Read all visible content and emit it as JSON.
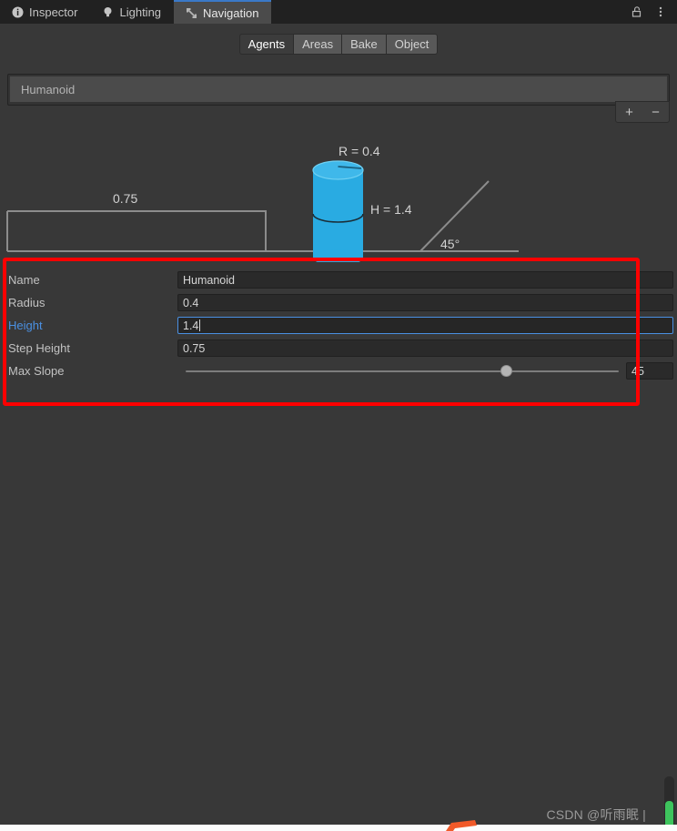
{
  "window": {
    "tabs": [
      {
        "label": "Inspector",
        "icon": "info-icon",
        "active": false
      },
      {
        "label": "Lighting",
        "icon": "lightbulb-icon",
        "active": false
      },
      {
        "label": "Navigation",
        "icon": "navmesh-icon",
        "active": true
      }
    ],
    "lock_icon": "lock-icon",
    "menu_icon": "kebab-menu-icon"
  },
  "toolbar": {
    "segments": [
      {
        "label": "Agents",
        "active": true
      },
      {
        "label": "Areas",
        "active": false
      },
      {
        "label": "Bake",
        "active": false
      },
      {
        "label": "Object",
        "active": false
      }
    ]
  },
  "agent_list": {
    "items": [
      {
        "label": "Humanoid",
        "selected": true
      }
    ],
    "add_label": "+",
    "remove_label": "−"
  },
  "diagram": {
    "step_label": "0.75",
    "radius_label": "R = 0.4",
    "height_label": "H = 1.4",
    "slope_label": "45°",
    "agent_color": "#29abe2",
    "agent_color_dark": "#1f9ed4",
    "line_color": "#8c8c8c"
  },
  "properties": {
    "highlight_color": "#fe0000",
    "rows": [
      {
        "label": "Name",
        "value": "Humanoid",
        "focused": false,
        "label_highlight": false
      },
      {
        "label": "Radius",
        "value": "0.4",
        "focused": false,
        "label_highlight": false
      },
      {
        "label": "Height",
        "value": "1.4",
        "focused": true,
        "label_highlight": true
      },
      {
        "label": "Step Height",
        "value": "0.75",
        "focused": false,
        "label_highlight": false
      }
    ],
    "slider_row": {
      "label": "Max Slope",
      "value": "45",
      "min": 0,
      "max": 60,
      "percent": 74
    }
  },
  "footer": {
    "watermark": "CSDN @听雨眠 |",
    "scrollbar_color": "#3ec45d"
  }
}
